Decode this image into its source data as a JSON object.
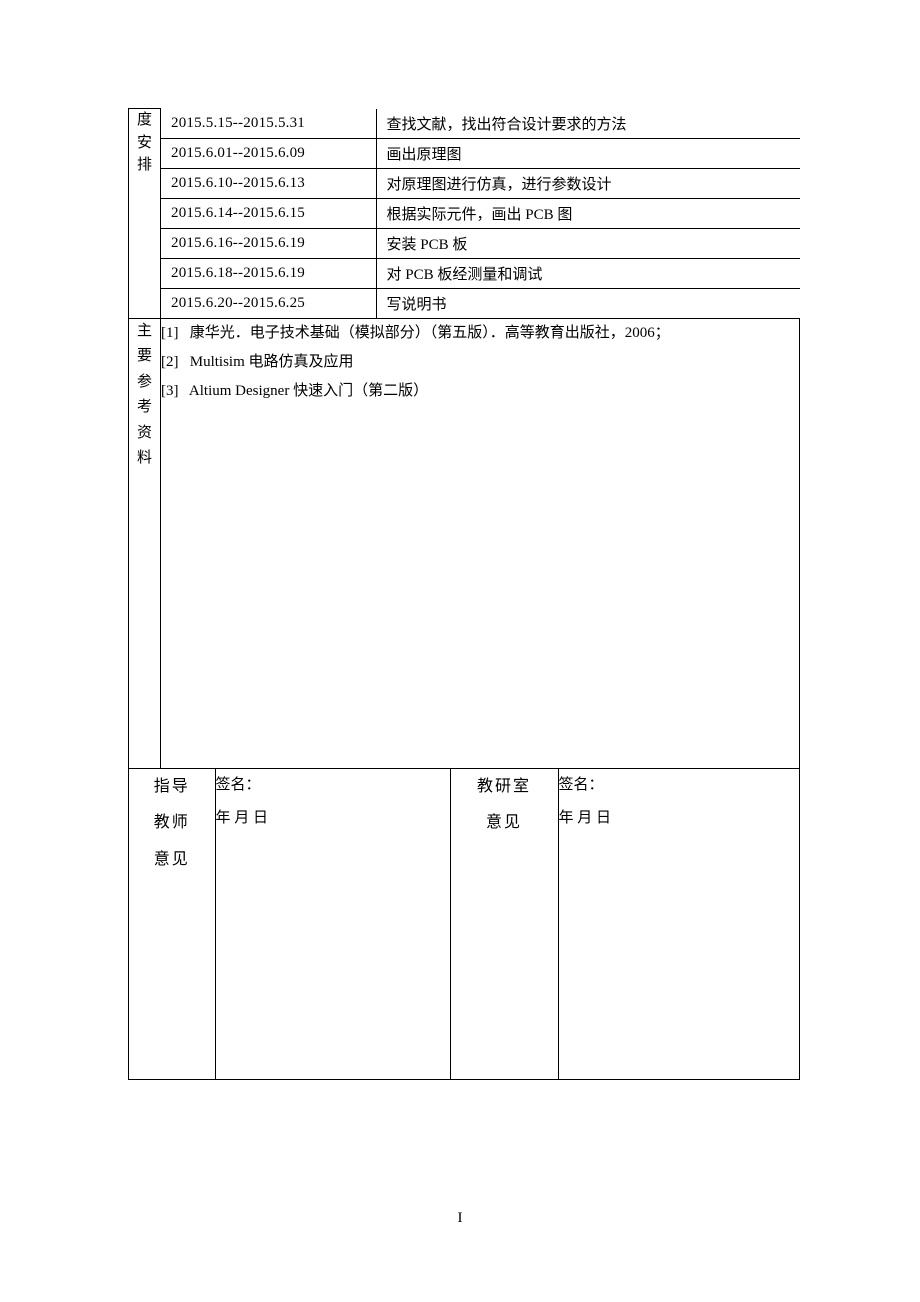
{
  "schedule": {
    "side_label_chars": "度安排",
    "rows": [
      {
        "dates": "2015.5.15--2015.5.31",
        "task": "查找文献，找出符合设计要求的方法"
      },
      {
        "dates": "2015.6.01--2015.6.09",
        "task": "画出原理图"
      },
      {
        "dates": "2015.6.10--2015.6.13",
        "task": "对原理图进行仿真，进行参数设计"
      },
      {
        "dates": "2015.6.14--2015.6.15",
        "task": "根据实际元件，画出 PCB 图"
      },
      {
        "dates": "2015.6.16--2015.6.19",
        "task": "安装 PCB 板"
      },
      {
        "dates": "2015.6.18--2015.6.19",
        "task": "对 PCB 板经测量和调试"
      },
      {
        "dates": "2015.6.20--2015.6.25",
        "task": "写说明书"
      }
    ]
  },
  "references": {
    "side_label_chars": "主要参考资料",
    "lines": [
      "[1]   康华光．电子技术基础（模拟部分）（第五版）．高等教育出版社，2006；",
      "[2]   Multisim 电路仿真及应用",
      "[3]   Altium Designer 快速入门（第二版）"
    ]
  },
  "signatures": {
    "left_label_line1": "指导",
    "left_label_line2": "教师",
    "left_label_line3": "意见",
    "right_label_line1": "教研室",
    "right_label_line2": "意见",
    "sig_label": "签名：",
    "date_label": "年   月   日"
  },
  "page_number": "I"
}
